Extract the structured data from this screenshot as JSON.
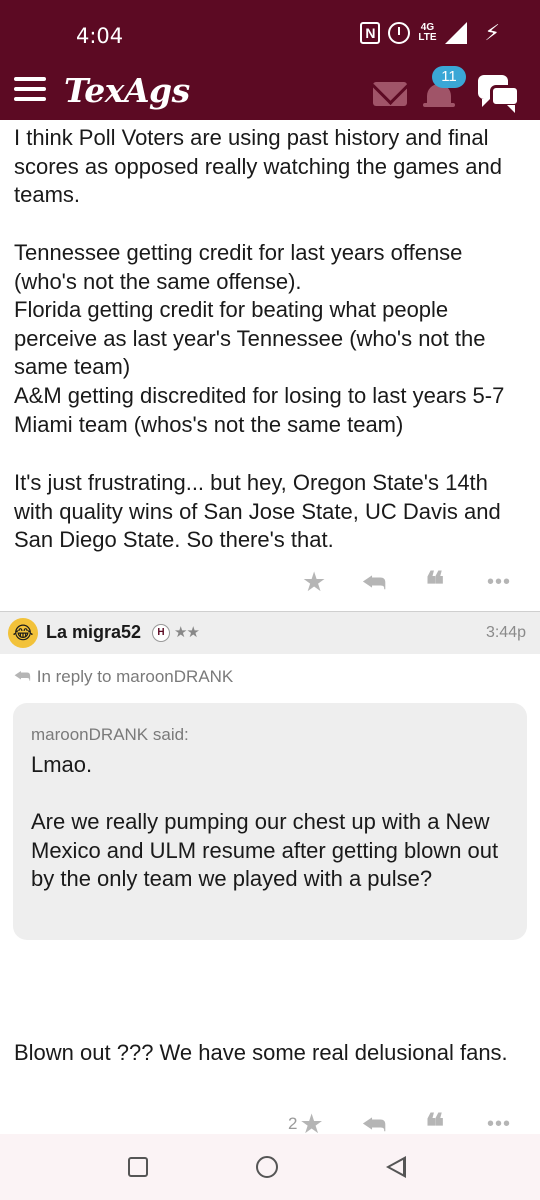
{
  "status_bar": {
    "time": "4:04",
    "network": "4G LTE"
  },
  "app_bar": {
    "logo": "TexAgs",
    "notification_count": "11",
    "colors": {
      "maroon": "#5c0a23",
      "badge": "#3aa7d6"
    }
  },
  "post1": {
    "paragraphs": [
      "I think Poll Voters are using past history and final scores as opposed really watching the games and teams.",
      "Tennessee getting credit for last years offense (who's not the same offense).",
      "Florida getting credit for beating what people perceive as last year's Tennessee (who's not the same team)",
      "A&M getting discredited for losing to last years 5-7 Miami team (whos's not the same team)",
      "It's just frustrating... but hey, Oregon State's 14th with quality wins of San Jose State, UC Davis and San Diego State. So there's that."
    ]
  },
  "post2": {
    "username": "La migra52",
    "member_badge": "H",
    "rank_stars": "★★",
    "time": "3:44p",
    "reply_to": "In reply to maroonDRANK",
    "quote": {
      "author_said": "maroonDRANK said:",
      "line1": "Lmao.",
      "line2": "Are we really pumping our chest up with a New Mexico and ULM resume after getting blown out by the only team we played with a pulse?"
    },
    "body": "Blown out ??? We have some real delusional fans.",
    "star_count": "2"
  },
  "icons": {
    "star": "★",
    "reply": "⮪",
    "quote": "❝",
    "more": "•••"
  }
}
